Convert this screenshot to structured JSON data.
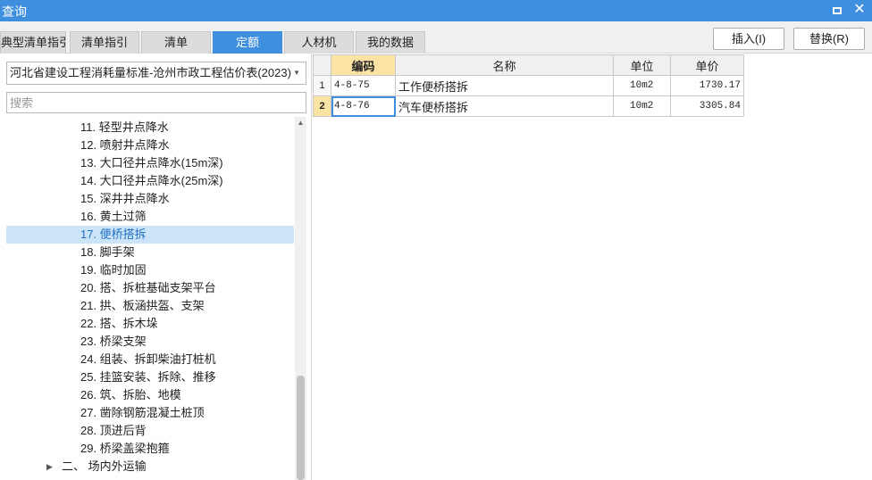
{
  "window": {
    "title": "查询"
  },
  "tabs": [
    {
      "label": "典型清单指引",
      "active": false
    },
    {
      "label": "清单指引",
      "active": false
    },
    {
      "label": "清单",
      "active": false
    },
    {
      "label": "定额",
      "active": true
    },
    {
      "label": "人材机",
      "active": false
    },
    {
      "label": "我的数据",
      "active": false
    }
  ],
  "actions": {
    "insert": "插入(I)",
    "replace": "替换(R)"
  },
  "library": {
    "selected": "河北省建设工程消耗量标准-沧州市政工程估价表(2023)"
  },
  "search": {
    "placeholder": "搜索",
    "value": ""
  },
  "tree": [
    {
      "label": "11. 轻型井点降水"
    },
    {
      "label": "12. 喷射井点降水"
    },
    {
      "label": "13. 大口径井点降水(15m深)"
    },
    {
      "label": "14. 大口径井点降水(25m深)"
    },
    {
      "label": "15. 深井井点降水"
    },
    {
      "label": "16. 黄土过筛"
    },
    {
      "label": "17. 便桥搭拆",
      "selected": true
    },
    {
      "label": "18. 脚手架"
    },
    {
      "label": "19. 临时加固"
    },
    {
      "label": "20. 搭、拆桩基础支架平台"
    },
    {
      "label": "21. 拱、板涵拱盔、支架"
    },
    {
      "label": "22. 搭、拆木垛"
    },
    {
      "label": "23. 桥梁支架"
    },
    {
      "label": "24. 组装、拆卸柴油打桩机"
    },
    {
      "label": "25. 挂篮安装、拆除、推移"
    },
    {
      "label": "26. 筑、拆胎、地模"
    },
    {
      "label": "27. 凿除钢筋混凝土桩顶"
    },
    {
      "label": "28. 顶进后背"
    },
    {
      "label": "29. 桥梁盖梁抱箍"
    },
    {
      "label": "二、 场内外运输",
      "group": true
    }
  ],
  "grid": {
    "columns": [
      "编码",
      "名称",
      "单位",
      "单价"
    ],
    "rows": [
      {
        "num": "1",
        "code": "4-8-75",
        "name": "工作便桥搭拆",
        "unit": "10m2",
        "price": "1730.17"
      },
      {
        "num": "2",
        "code": "4-8-76",
        "name": "汽车便桥搭拆",
        "unit": "10m2",
        "price": "3305.84",
        "current": true
      }
    ]
  },
  "colors": {
    "accent": "#3f8fdf",
    "selection": "#cce4f7",
    "sorted_header": "#fbe3a6"
  }
}
